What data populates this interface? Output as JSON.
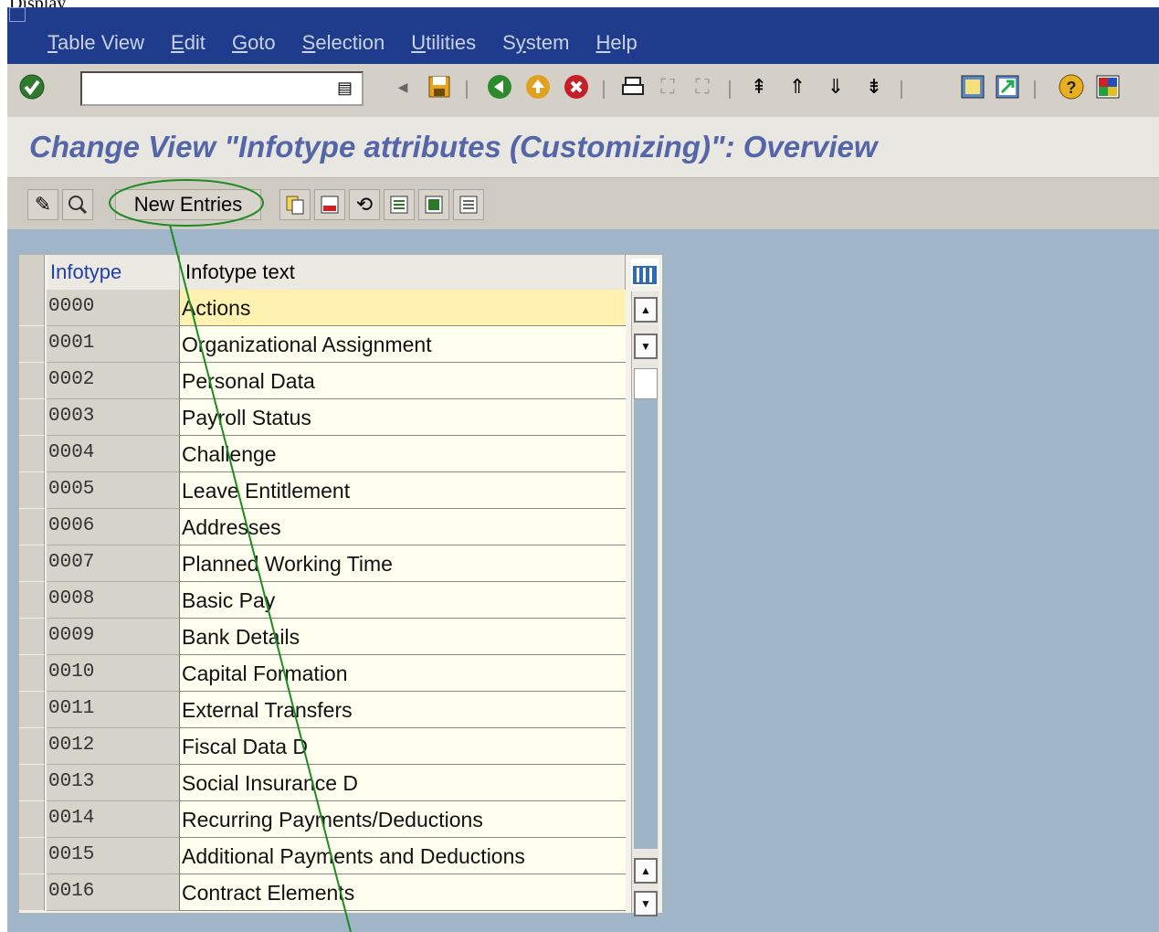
{
  "menubar": {
    "items": [
      {
        "label": "Table View",
        "mnemonic": "T",
        "rest": "able View"
      },
      {
        "label": "Edit",
        "mnemonic": "E",
        "rest": "dit"
      },
      {
        "label": "Goto",
        "mnemonic": "G",
        "rest": "oto"
      },
      {
        "label": "Selection",
        "mnemonic": "S",
        "rest": "election"
      },
      {
        "label": "Utilities",
        "mnemonic": "U",
        "rest": "tilities"
      },
      {
        "label": "System",
        "mnemonic": "y",
        "rest": "stem",
        "prefix": "S"
      },
      {
        "label": "Help",
        "mnemonic": "H",
        "rest": "elp"
      }
    ]
  },
  "toolbar": {
    "command_field_value": "",
    "icons": [
      "check-icon",
      "back-icon",
      "save-icon",
      "back-green-icon",
      "exit-icon",
      "cancel-icon",
      "print-icon",
      "find-icon",
      "find-next-icon",
      "first-page-icon",
      "prev-page-icon",
      "next-page-icon",
      "last-page-icon",
      "create-session-icon",
      "shortcut-icon",
      "help-icon",
      "layout-icon"
    ]
  },
  "page": {
    "title": "Change View \"Infotype attributes (Customizing)\": Overview"
  },
  "app_toolbar": {
    "new_entries_label": "New Entries"
  },
  "table": {
    "headers": {
      "infotype": "Infotype",
      "text": "Infotype text"
    },
    "rows": [
      {
        "code": "0000",
        "text": "Actions"
      },
      {
        "code": "0001",
        "text": "Organizational Assignment"
      },
      {
        "code": "0002",
        "text": "Personal Data"
      },
      {
        "code": "0003",
        "text": "Payroll Status"
      },
      {
        "code": "0004",
        "text": "Challenge"
      },
      {
        "code": "0005",
        "text": "Leave Entitlement"
      },
      {
        "code": "0006",
        "text": "Addresses"
      },
      {
        "code": "0007",
        "text": "Planned Working Time"
      },
      {
        "code": "0008",
        "text": "Basic Pay"
      },
      {
        "code": "0009",
        "text": "Bank Details"
      },
      {
        "code": "0010",
        "text": "Capital Formation"
      },
      {
        "code": "0011",
        "text": "External Transfers"
      },
      {
        "code": "0012",
        "text": "Fiscal Data  D"
      },
      {
        "code": "0013",
        "text": "Social Insurance  D"
      },
      {
        "code": "0014",
        "text": "Recurring Payments/Deductions"
      },
      {
        "code": "0015",
        "text": "Additional Payments and Deductions"
      },
      {
        "code": "0016",
        "text": "Contract Elements"
      }
    ]
  },
  "colors": {
    "menubar_bg": "#1f3b8c",
    "title": "#5566a8",
    "frame_bg": "#a0b6c8",
    "annotation": "#1e8a22"
  }
}
